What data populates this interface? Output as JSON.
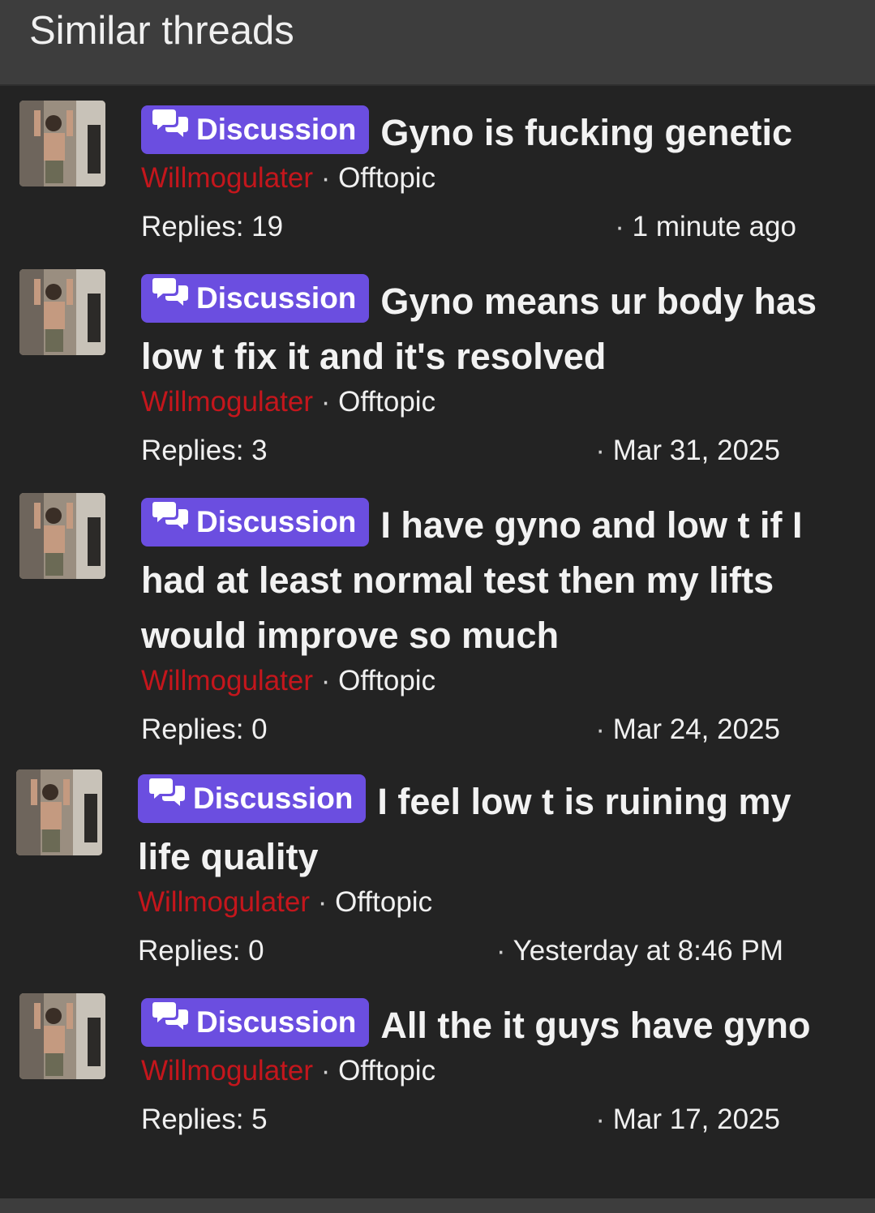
{
  "header": {
    "title": "Similar threads"
  },
  "icons": {
    "badge": "chat-bubbles-icon",
    "avatar": "user-avatar-photo"
  },
  "colors": {
    "badge": "#6b4ee0",
    "author": "#c4161c",
    "background": "#232323",
    "header": "#3d3d3d"
  },
  "threads": [
    {
      "badge": "Discussion",
      "title": "Gyno is fucking genetic",
      "author": "Willmogulater",
      "forum": "Offtopic",
      "replies": "Replies: 19",
      "date": "1 minute ago"
    },
    {
      "badge": "Discussion",
      "title": "Gyno means ur body has low t fix it and it's resolved",
      "author": "Willmogulater",
      "forum": "Offtopic",
      "replies": "Replies: 3",
      "date": "Mar 31, 2025"
    },
    {
      "badge": "Discussion",
      "title": "I have gyno and low t if I had at least normal test then my lifts would improve so much",
      "author": "Willmogulater",
      "forum": "Offtopic",
      "replies": "Replies: 0",
      "date": "Mar 24, 2025"
    },
    {
      "badge": "Discussion",
      "title": "I feel low t is ruining my life quality",
      "author": "Willmogulater",
      "forum": "Offtopic",
      "replies": "Replies: 0",
      "date": "Yesterday at 8:46 PM"
    },
    {
      "badge": "Discussion",
      "title": "All the it guys have gyno",
      "author": "Willmogulater",
      "forum": "Offtopic",
      "replies": "Replies: 5",
      "date": "Mar 17, 2025"
    }
  ]
}
